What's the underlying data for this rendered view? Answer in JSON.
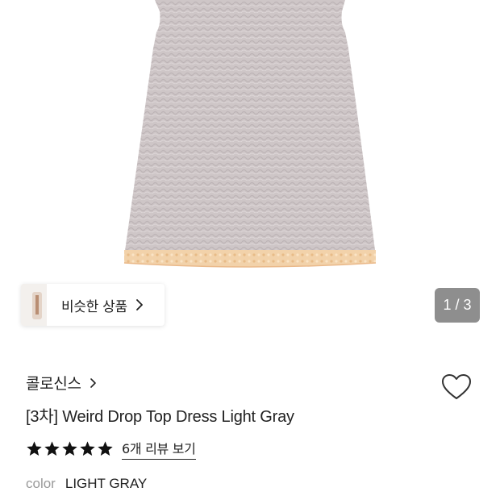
{
  "gallery": {
    "similar_label": "비슷한 상품",
    "page_counter": "1 / 3",
    "current_page": 1,
    "total_pages": 3
  },
  "product": {
    "brand": "콜로신스",
    "title": "[3차] Weird Drop Top Dress Light Gray",
    "rating": 5,
    "review_link": "6개 리뷰 보기",
    "option_key": "color",
    "option_value": "LIGHT GRAY"
  },
  "icons": {
    "wishlist": "heart-outline-icon",
    "brand_chevron": "chevron-right-icon",
    "similar_chevron": "chevron-right-icon",
    "star": "star-filled-icon"
  },
  "colors": {
    "dress": "#cfc7c8",
    "lace_trim": "#f1cfa6",
    "counter_bg": "#8e8e8e",
    "text": "#222222",
    "muted": "#9a9a9a"
  }
}
